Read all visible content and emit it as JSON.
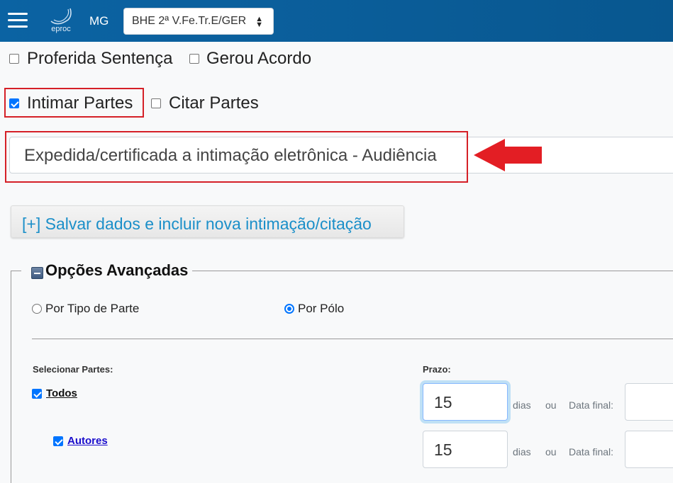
{
  "header": {
    "state": "MG",
    "logo_text": "eproc",
    "unit_select": "BHE 2ª V.Fe.Tr.E/GER"
  },
  "checkboxes_row1": [
    {
      "label": "Proferida Sentença",
      "checked": false
    },
    {
      "label": "Gerou Acordo",
      "checked": false
    }
  ],
  "checkboxes_row2": [
    {
      "label": "Intimar Partes",
      "checked": true
    },
    {
      "label": "Citar Partes",
      "checked": false
    }
  ],
  "event_text": "Expedida/certificada a intimação eletrônica - Audiência",
  "save_button": "[+] Salvar dados e incluir nova intimação/citação",
  "advanced": {
    "title": "Opções Avançadas",
    "options": [
      {
        "label": "Por Tipo de Parte",
        "checked": false
      },
      {
        "label": "Por Pólo",
        "checked": true
      }
    ],
    "select_parts_label": "Selecionar Partes:",
    "prazo_label": "Prazo:",
    "rows": [
      {
        "party": "Todos",
        "checked": true,
        "prazo": "15",
        "days": "dias",
        "or": "ou",
        "date_label": "Data final:"
      },
      {
        "party": "Autores",
        "checked": true,
        "prazo": "15",
        "days": "dias",
        "or": "ou",
        "date_label": "Data final:"
      }
    ]
  },
  "colors": {
    "header": "#0b63a3",
    "highlight": "#d52027",
    "link_blue": "#1b8fc9",
    "checkbox": "#0075ff"
  }
}
